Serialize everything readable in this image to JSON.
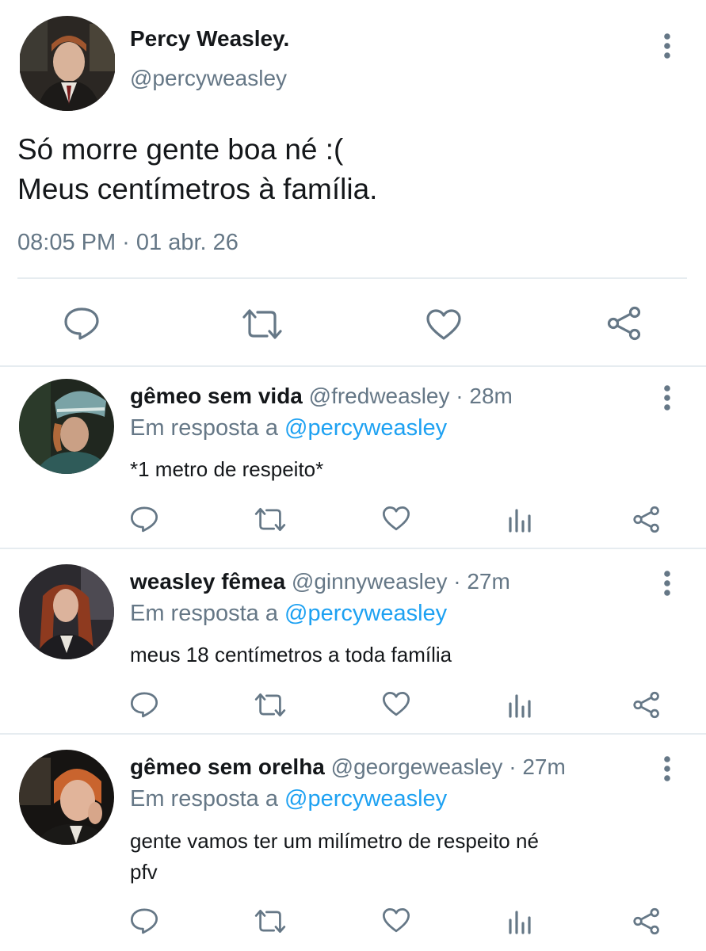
{
  "main_tweet": {
    "author_name": "Percy Weasley.",
    "handle": "@percyweasley",
    "text_line1": "Só morre gente boa né :(",
    "text_line2": "Meus centímetros à família.",
    "timestamp": "08:05 PM · 01 abr. 26",
    "actions": [
      "reply-icon",
      "retweet-icon",
      "like-icon",
      "share-icon"
    ]
  },
  "replies": [
    {
      "name": "gêmeo sem vida",
      "handle": "@fredweasley",
      "time": "· 28m",
      "reply_prefix": "Em resposta a",
      "reply_to": "@percyweasley",
      "text": "*1 metro de respeito*"
    },
    {
      "name": "weasley fêmea",
      "handle": "@ginnyweasley",
      "time": "· 27m",
      "reply_prefix": "Em resposta a",
      "reply_to": "@percyweasley",
      "text": "meus 18 centímetros a toda família"
    },
    {
      "name": "gêmeo sem orelha",
      "handle": "@georgeweasley",
      "time": "· 27m",
      "reply_prefix": "Em resposta a",
      "reply_to": "@percyweasley",
      "text_line1": "gente vamos ter um milímetro de respeito né",
      "text_line2": "pfv"
    }
  ],
  "colors": {
    "text": "#14171a",
    "muted": "#657786",
    "link": "#1da1f2",
    "divider": "#e6ecf0"
  }
}
